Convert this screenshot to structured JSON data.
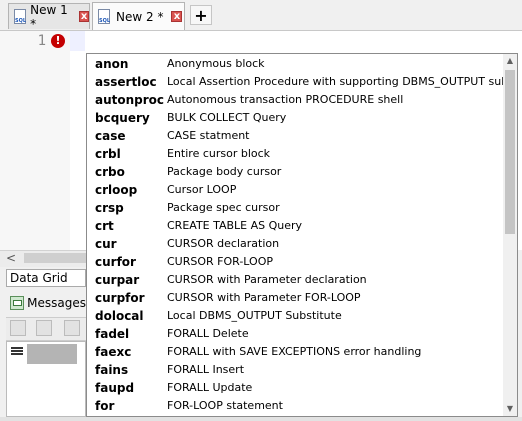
{
  "tabs": [
    {
      "label": "New 1 *",
      "icon": "sql-file-icon"
    },
    {
      "label": "New 2 *",
      "icon": "sql-file-icon"
    }
  ],
  "new_tab_label": "+",
  "close_glyph": "x",
  "editor": {
    "line_number": "1",
    "error_glyph": "!"
  },
  "scroll_left_glyph": "<",
  "bottom_panel": {
    "data_grid_label": "Data Grid",
    "messages_label": "Messages"
  },
  "autocomplete": {
    "items": [
      {
        "keyword": "anon",
        "description": "Anonymous block"
      },
      {
        "keyword": "assertloc",
        "description": "Local Assertion Procedure with supporting DBMS_OUTPUT substitute"
      },
      {
        "keyword": "autonproc",
        "description": "Autonomous transaction PROCEDURE shell"
      },
      {
        "keyword": "bcquery",
        "description": "BULK COLLECT Query"
      },
      {
        "keyword": "case",
        "description": "CASE statment"
      },
      {
        "keyword": "crbl",
        "description": "Entire cursor block"
      },
      {
        "keyword": "crbo",
        "description": "Package body cursor"
      },
      {
        "keyword": "crloop",
        "description": "Cursor LOOP"
      },
      {
        "keyword": "crsp",
        "description": "Package spec cursor"
      },
      {
        "keyword": "crt",
        "description": "CREATE TABLE AS Query"
      },
      {
        "keyword": "cur",
        "description": "CURSOR declaration"
      },
      {
        "keyword": "curfor",
        "description": "CURSOR FOR-LOOP"
      },
      {
        "keyword": "curpar",
        "description": "CURSOR with Parameter declaration"
      },
      {
        "keyword": "curpfor",
        "description": "CURSOR with Parameter FOR-LOOP"
      },
      {
        "keyword": "dolocal",
        "description": "Local DBMS_OUTPUT Substitute"
      },
      {
        "keyword": "fadel",
        "description": "FORALL Delete"
      },
      {
        "keyword": "faexc",
        "description": "FORALL with SAVE EXCEPTIONS error handling"
      },
      {
        "keyword": "fains",
        "description": "FORALL Insert"
      },
      {
        "keyword": "faupd",
        "description": "FORALL Update"
      },
      {
        "keyword": "for",
        "description": "FOR-LOOP statement"
      }
    ],
    "scroll_up_glyph": "▲",
    "scroll_down_glyph": "▼"
  }
}
